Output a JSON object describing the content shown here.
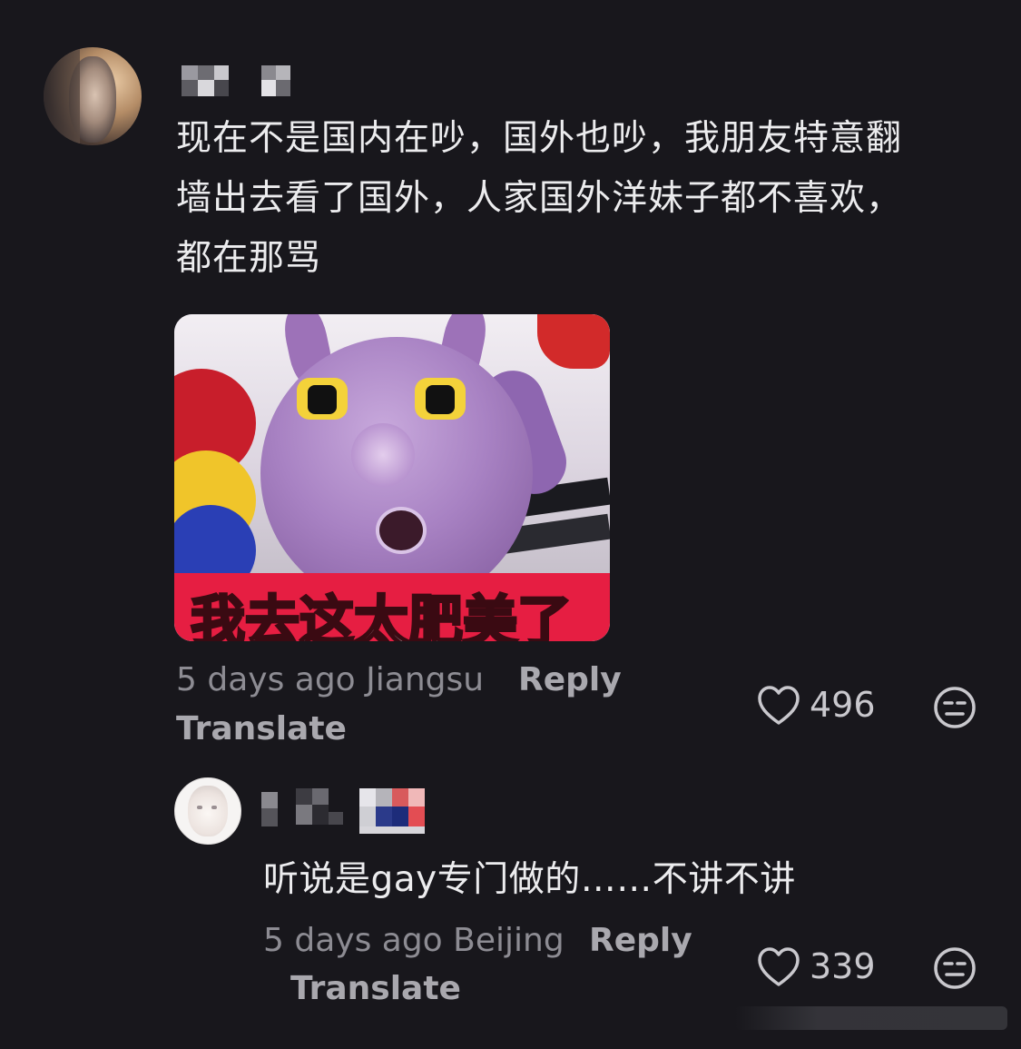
{
  "comments": [
    {
      "text_lines": [
        "现在不是国内在吵，国外也吵，我朋友特意翻",
        "墙出去看了国外，人家国外洋妹子都不喜欢，",
        "都在那骂"
      ],
      "sticker_caption": "我去这太肥美了",
      "meta": "5 days ago Jiangsu",
      "reply_label": "Reply",
      "translate_label": "Translate",
      "like_count": "496",
      "like_icon": "heart-outline-icon",
      "dislike_icon": "expressionless-face-icon"
    },
    {
      "text": "听说是gay专门做的……不讲不讲",
      "meta": "5 days ago Beijing",
      "reply_label": "Reply",
      "translate_label": "Translate",
      "like_count": "339",
      "like_icon": "heart-outline-icon",
      "dislike_icon": "expressionless-face-icon"
    }
  ],
  "colors": {
    "background": "#18171c",
    "text": "#ececee",
    "meta": "#8d8c93",
    "action": "#a9a8ae"
  }
}
